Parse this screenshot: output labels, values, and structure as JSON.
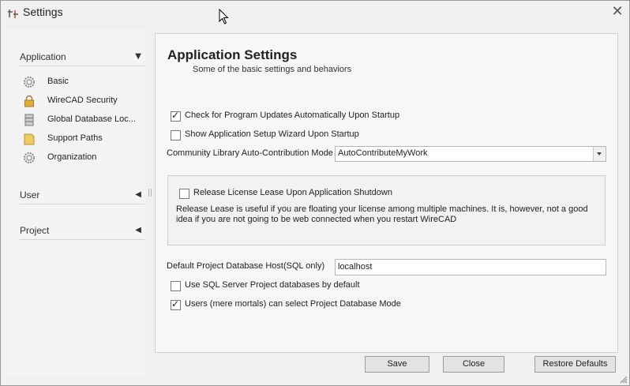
{
  "window": {
    "title": "Settings"
  },
  "sidebar": {
    "groups": [
      {
        "label": "Application",
        "items": [
          {
            "label": "Basic",
            "icon": "gear-icon"
          },
          {
            "label": "WireCAD Security",
            "icon": "lock-icon"
          },
          {
            "label": "Global Database Loc...",
            "icon": "database-icon"
          },
          {
            "label": "Support Paths",
            "icon": "folder-icon"
          },
          {
            "label": "Organization",
            "icon": "gear-icon"
          }
        ]
      },
      {
        "label": "User",
        "items": []
      },
      {
        "label": "Project",
        "items": []
      }
    ]
  },
  "main": {
    "title": "Application Settings",
    "subtitle": "Some of the basic settings and behaviors",
    "check_updates": {
      "label": "Check for Program Updates Automatically Upon Startup",
      "checked": true
    },
    "show_wizard": {
      "label": "Show Application Setup Wizard Upon Startup",
      "checked": false
    },
    "community": {
      "label": "Community Library Auto-Contribution Mode",
      "value": "AutoContributeMyWork"
    },
    "license": {
      "label": "Release License Lease Upon Application Shutdown",
      "checked": false,
      "description": "Release Lease is useful if you are floating your license among multiple machines. It is, however, not a good idea if you are not going to be web connected when you restart WireCAD"
    },
    "db_host": {
      "label": "Default Project Database Host(SQL only)",
      "value": "localhost"
    },
    "use_sql": {
      "label": "Use SQL Server Project databases by default",
      "checked": false
    },
    "users_select": {
      "label": "Users (mere mortals) can select Project Database Mode",
      "checked": true
    }
  },
  "buttons": {
    "save": "Save",
    "close": "Close",
    "restore": "Restore Defaults"
  }
}
